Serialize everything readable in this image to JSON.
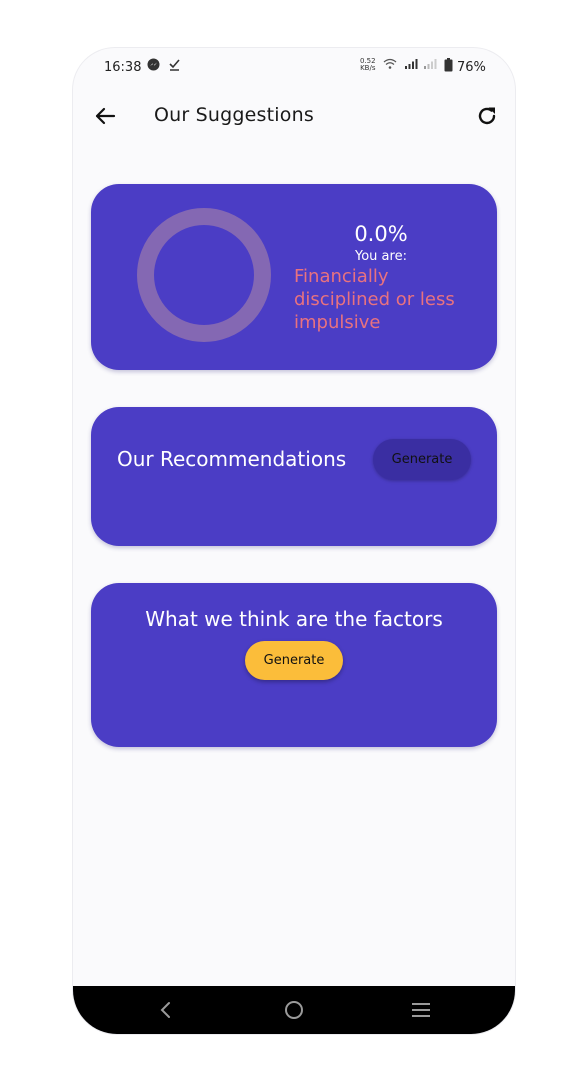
{
  "status_bar": {
    "time": "16:38",
    "net_speed_value": "0.52",
    "net_speed_unit": "KB/s",
    "battery": "76%"
  },
  "app_bar": {
    "title": "Our Suggestions"
  },
  "score_card": {
    "percentage": "0.0%",
    "progress": 0.0,
    "you_are_label": "You are:",
    "verdict": "Financially disciplined or less impulsive",
    "ring_color": "#8468b3",
    "verdict_color": "#e8727f"
  },
  "recommendations_card": {
    "title": "Our Recommendations",
    "button_label": "Generate"
  },
  "factors_card": {
    "title": "What we think are the factors",
    "button_label": "Generate"
  },
  "colors": {
    "card_background": "#4b3dc5",
    "accent_yellow": "#fbbd3a"
  }
}
